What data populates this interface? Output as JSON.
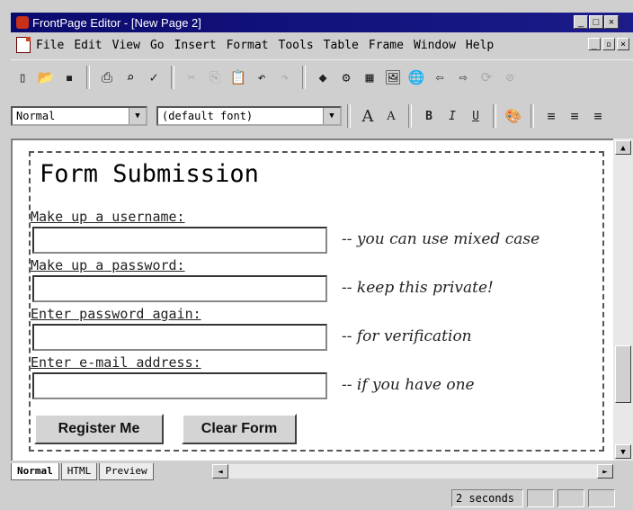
{
  "window": {
    "title": "FrontPage Editor - [New Page 2]"
  },
  "menu": [
    "File",
    "Edit",
    "View",
    "Go",
    "Insert",
    "Format",
    "Tools",
    "Table",
    "Frame",
    "Window",
    "Help"
  ],
  "toolbar": {
    "style_value": "Normal",
    "font_value": "(default font)"
  },
  "form": {
    "title": "Form Submission",
    "fields": [
      {
        "label": "Make up a username:",
        "hint": "-- you can use mixed case"
      },
      {
        "label": "Make up a password:",
        "hint": "-- keep this private!"
      },
      {
        "label": "Enter password again:",
        "hint": "-- for verification"
      },
      {
        "label": "Enter e-mail address:",
        "hint": "-- if you have one"
      }
    ],
    "register_label": "Register Me",
    "clear_label": "Clear Form"
  },
  "tabs": [
    "Normal",
    "HTML",
    "Preview"
  ],
  "status": {
    "time": "2 seconds"
  }
}
